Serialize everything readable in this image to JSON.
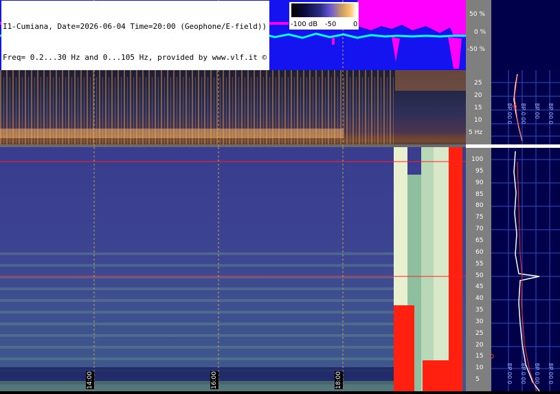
{
  "header": {
    "line1": "I1-Cumiana, Date=2026-06-04 Time=20:00 (Geophone/E-field))",
    "line2": "Freq= 0.2...30 Hz and 0...105 Hz, provided by www.vlf.it ©"
  },
  "colorbar": {
    "labels": [
      "-100 dB",
      "-50",
      "0"
    ]
  },
  "amplitude_scale": {
    "labels": [
      "50 %",
      "0 %",
      "-50 %"
    ]
  },
  "low_freq_scale": {
    "labels": [
      "25",
      "20",
      "15",
      "10",
      "5 Hz"
    ]
  },
  "high_freq_scale": {
    "labels": [
      "100",
      "95",
      "90",
      "85",
      "80",
      "75",
      "70",
      "65",
      "60",
      "55",
      "50",
      "45",
      "40",
      "35",
      "30",
      "25",
      "20",
      "15",
      "10",
      "5"
    ]
  },
  "time_labels": [
    "14:00",
    "16:00",
    "18:00"
  ],
  "spectrum_panel": {
    "top_labels": [
      "BP 00 0",
      "BP 0 00",
      "BP 00",
      "BP 00 0"
    ],
    "bottom_labels": [
      "BP 00 0",
      "BP 0 00",
      "BP 0 00",
      "BP 00 0"
    ]
  },
  "colors": {
    "waveform_background": "#1414f0",
    "amplitude_trace": "#ff00ff",
    "signal_trace": "#00ffff",
    "marker_line": "#ff2020",
    "scale_background": "#7f7f7f",
    "spectrum_panel_background": "#00004a"
  }
}
